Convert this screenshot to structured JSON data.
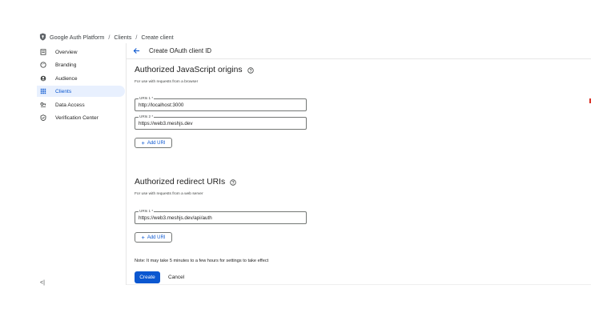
{
  "breadcrumb": {
    "items": [
      "Google Auth Platform",
      "Clients",
      "Create client"
    ],
    "separator": "/"
  },
  "sidebar": {
    "items": [
      {
        "label": "Overview",
        "icon": "dashboard-icon",
        "active": false
      },
      {
        "label": "Branding",
        "icon": "palette-icon",
        "active": false
      },
      {
        "label": "Audience",
        "icon": "people-icon",
        "active": false
      },
      {
        "label": "Clients",
        "icon": "grid-icon",
        "active": true
      },
      {
        "label": "Data Access",
        "icon": "key-icon",
        "active": false
      },
      {
        "label": "Verification Center",
        "icon": "verified-icon",
        "active": false
      }
    ],
    "collapse_label": "<|"
  },
  "header": {
    "title": "Create OAuth client ID"
  },
  "js_origins": {
    "title": "Authorized JavaScript origins",
    "subtitle": "For use with requests from a browser",
    "uris": [
      {
        "label": "URIs 1 *",
        "value": "http://localhost:3000"
      },
      {
        "label": "URIs 2 *",
        "value": "https://web3.meshjs.dev"
      }
    ],
    "add_label": "Add URI"
  },
  "redirect_uris": {
    "title": "Authorized redirect URIs",
    "subtitle": "For use with requests from a web server",
    "uris": [
      {
        "label": "URIs 1 *",
        "value": "https://web3.meshjs.dev/api/auth"
      }
    ],
    "add_label": "Add URI"
  },
  "footer": {
    "note": "Note: It may take 5 minutes to a few hours for settings to take effect",
    "create_label": "Create",
    "cancel_label": "Cancel"
  },
  "colors": {
    "accent": "#0b57d0",
    "active_bg": "#e8f0fe"
  }
}
